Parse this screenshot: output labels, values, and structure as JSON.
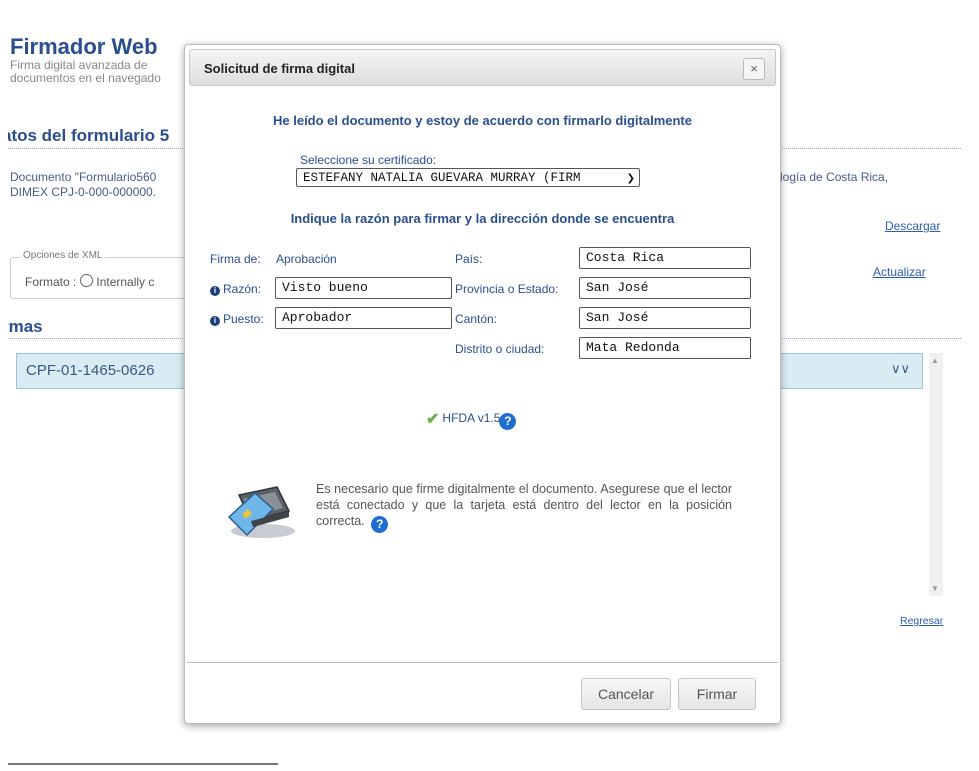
{
  "background": {
    "app_title": "Firmador Web",
    "app_subtitle_line1": "Firma digital avanzada de",
    "app_subtitle_line2": "documentos en el navegado",
    "section_form_title": "atos del formulario 5",
    "doc_text_line1": "Documento \"Formulario560",
    "doc_text_line2": "DIMEX CPJ-0-000-000000.",
    "doc_text_right": "logía de Costa Rica,",
    "download_link": "Descargar",
    "xml_options_legend": "Opciones de XML",
    "xml_format_label": "Formato :",
    "xml_format_option": "Internally c",
    "update_link": "Actualizar",
    "section_signatures_title": "rmas",
    "signature_id": "CPF-01-1465-0626",
    "back_link": "Regresar"
  },
  "dialog": {
    "title": "Solicitud de firma digital",
    "close_symbol": "×",
    "agreement_heading": "He leído el documento y estoy de acuerdo con firmarlo digitalmente",
    "certificate_label": "Seleccione su certificado:",
    "certificate_selected": "ESTEFANY NATALIA GUEVARA MURRAY (FIRM",
    "reason_heading": "Indique la razón para firmar y la dirección donde se encuentra",
    "fields": {
      "firma_de_label": "Firma de:",
      "firma_de_value": "Aprobación",
      "razon_label": "Razón:",
      "razon_value": "Visto bueno",
      "puesto_label": "Puesto:",
      "puesto_value": "Aprobador",
      "pais_label": "País:",
      "pais_value": "Costa Rica",
      "provincia_label": "Provincia o Estado:",
      "provincia_value": "San José",
      "canton_label": "Cantón:",
      "canton_value": "San José",
      "distrito_label": "Distrito o ciudad:",
      "distrito_value": "Mata Redonda"
    },
    "version_label": "HFDA v1.5",
    "instruction_message": "Es necesario que firme digitalmente el documento. Asegurese que el lector está conectado y que la tarjeta está dentro del lector en la posición correcta.",
    "cancel_button": "Cancelar",
    "sign_button": "Firmar"
  },
  "colors": {
    "heading_blue": "#2a4f8e",
    "help_icon_blue": "#1f6fd0",
    "check_green": "#6ab04c",
    "signature_bar": "#d9ecf4"
  }
}
